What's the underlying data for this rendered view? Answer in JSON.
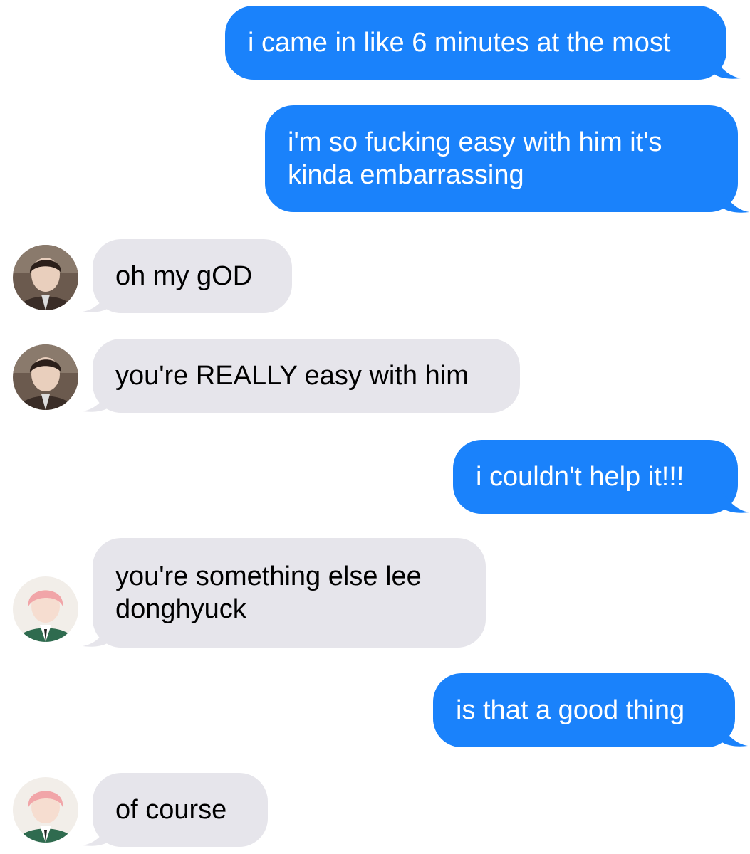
{
  "colors": {
    "outgoing_bubble": "#1a82fb",
    "incoming_bubble": "#e6e5eb",
    "outgoing_text": "#ffffff",
    "incoming_text": "#000000"
  },
  "messages": [
    {
      "sender": "me",
      "text": "i came in like 6 minutes at the most"
    },
    {
      "sender": "me",
      "text": "i'm so fucking easy with him it's kinda embarrassing"
    },
    {
      "sender": "contact-1",
      "avatar": "avatar-dark-hair",
      "text": "oh my gOD"
    },
    {
      "sender": "contact-1",
      "avatar": "avatar-dark-hair",
      "text": "you're REALLY easy with him"
    },
    {
      "sender": "me",
      "text": "i couldn't help it!!!"
    },
    {
      "sender": "contact-2",
      "avatar": "avatar-pink-hair",
      "text": "you're something else lee donghyuck"
    },
    {
      "sender": "me",
      "text": "is that a good thing"
    },
    {
      "sender": "contact-2",
      "avatar": "avatar-pink-hair",
      "text": "of course"
    }
  ]
}
